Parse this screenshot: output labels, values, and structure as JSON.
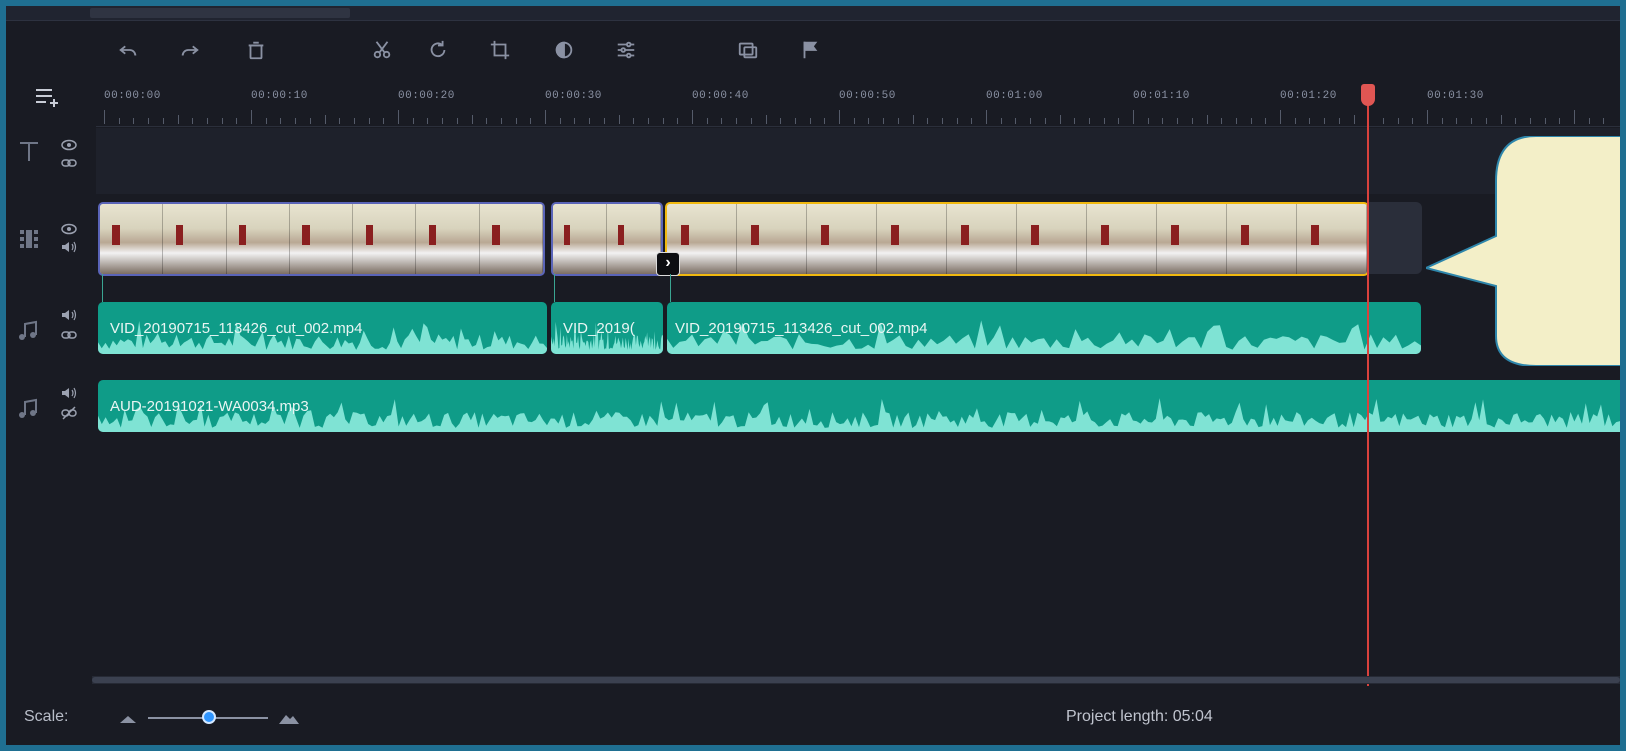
{
  "timeline": {
    "ruler_labels": [
      "00:00:00",
      "00:00:10",
      "00:00:20",
      "00:00:30",
      "00:00:40",
      "00:00:50",
      "00:01:00",
      "00:01:10",
      "00:01:20",
      "00:01:30"
    ]
  },
  "toolbar": {
    "icons": [
      "undo-icon",
      "redo-icon",
      "delete-icon",
      "cut-icon",
      "rotate-icon",
      "crop-icon",
      "color-adjust-icon",
      "clip-properties-icon",
      "overlay-icon",
      "marker-flag-icon"
    ]
  },
  "tracks": {
    "video_clips": [
      {
        "name": "video-clip-1",
        "style": "blue"
      },
      {
        "name": "video-clip-2",
        "style": "blue"
      },
      {
        "name": "video-clip-3-selected",
        "style": "yellow"
      }
    ],
    "audio1_clips": [
      {
        "label": "VID_20190715_113426_cut_002.mp4"
      },
      {
        "label": "VID_2019("
      },
      {
        "label": "VID_20190715_113426_cut_002.mp4"
      }
    ],
    "audio2_clip": {
      "label": "AUD-20191021-WA0034.mp3"
    }
  },
  "footer": {
    "scale_label": "Scale:",
    "project_length": "Project length: 05:04"
  },
  "colors": {
    "background": "#191b23",
    "audio_clip": "#0f9c88",
    "selected_clip_border": "#f1b90f",
    "clip_border": "#5a64b8",
    "playhead": "#d9423d",
    "callout": "#f3efc8"
  }
}
